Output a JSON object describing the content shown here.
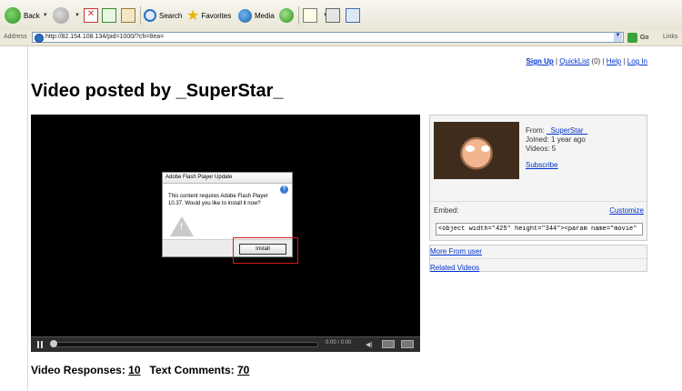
{
  "browser": {
    "back_label": "Back",
    "search_label": "Search",
    "favorites_label": "Favorites",
    "media_label": "Media",
    "address_label": "Address",
    "url": "http://82.154.108.134/pid=1000/?ch=8ea=",
    "go_label": "Go",
    "links_label": "Links"
  },
  "top_links": {
    "signup": "Sign Up",
    "quicklist": "QuickList",
    "quicklist_count": "(0)",
    "help": "Help",
    "login": "Log In"
  },
  "page_title": "Video posted by _SuperStar_",
  "player": {
    "time": "0:00 / 0:00",
    "progress": 0
  },
  "flash_dialog": {
    "title": "Adobe Flash Player Update",
    "message": "This content requires Adobe Flash Player 10.37. Would you like to install it now?",
    "install_label": "Install"
  },
  "uploader": {
    "from_label": "From:",
    "from_name": "_SuperStar_",
    "joined": "Joined: 1 year ago",
    "videos": "Videos: 5",
    "subscribe": "Subscribe"
  },
  "embed": {
    "label": "Embed:",
    "customize": "Customize",
    "code": "<object width=\"425\" height=\"344\"><param name=\"movie\""
  },
  "more_links": {
    "more_from_user": "More From user",
    "related_videos": "Related Videos"
  },
  "responses": {
    "video_label": "Video Responses:",
    "video_count": "10",
    "comments_label": "Text Comments:",
    "comments_count": "70"
  }
}
